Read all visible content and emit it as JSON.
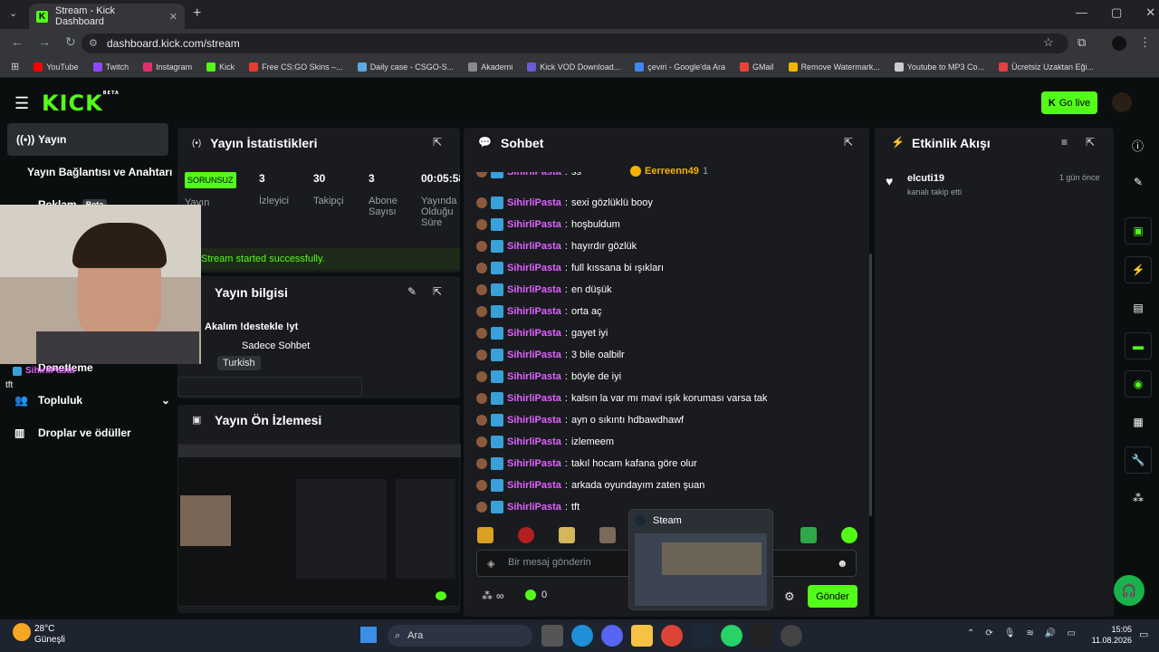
{
  "browser": {
    "tab_title": "Stream - Kick Dashboard",
    "url": "dashboard.kick.com/stream"
  },
  "bookmarks": [
    {
      "label": "YouTube",
      "color": "#ff0000"
    },
    {
      "label": "Twitch",
      "color": "#9146ff"
    },
    {
      "label": "Instagram",
      "color": "#e1306c"
    },
    {
      "label": "Kick",
      "color": "#53fc18"
    },
    {
      "label": "Free CS:GO Skins –...",
      "color": "#e63b2e"
    },
    {
      "label": "Daily case - CSGO-S...",
      "color": "#5aa9e6"
    },
    {
      "label": "Akademi",
      "color": "#8a8a8a"
    },
    {
      "label": "Kick VOD Download...",
      "color": "#6b5bd6"
    },
    {
      "label": "çeviri - Google'da Ara",
      "color": "#4285f4"
    },
    {
      "label": "GMail",
      "color": "#ea4335"
    },
    {
      "label": "Remove Watermark...",
      "color": "#f5b400"
    },
    {
      "label": "Youtube to MP3 Co...",
      "color": "#cccccc"
    },
    {
      "label": "Ücretsiz Uzaktan Eği...",
      "color": "#e04040"
    }
  ],
  "header": {
    "logo": "KICK",
    "logo_sup": "BETA",
    "go_live": "Go live"
  },
  "sidebar": {
    "items": [
      "Yayın",
      "Yayın Bağlantısı ve Anahtarı",
      "Reklam",
      "Beta",
      "Denetleme",
      "Topluluk",
      "Droplar ve ödüller"
    ]
  },
  "overlay": {
    "chat_name": "SihirliPasta",
    "chat_msg": "tft"
  },
  "stats": {
    "title": "Yayın İstatistikleri",
    "status": "SORUNSUZ",
    "status_label": "Yayın",
    "viewers": "3",
    "viewers_label": "İzleyici",
    "followers": "30",
    "followers_label": "Takipçi",
    "subs": "3",
    "subs_label": "Abone Sayısı",
    "time": "00:05:58",
    "time_label": "Yayında Olduğu Süre",
    "success": "Stream started successfully."
  },
  "info": {
    "title": "Yayın bilgisi",
    "stream_title": "Akalım !destekle !yt",
    "category": "Sadece Sohbet",
    "tag": "Turkish"
  },
  "preview": {
    "title": "Yayın Ön İzlemesi"
  },
  "chat": {
    "title": "Sohbet",
    "top_user": "Eerreenn49",
    "top_count": "1",
    "partial_msg": "ss",
    "messages": [
      "sexi gözlüklü booy",
      "hoşbuldum",
      "hayırdır gözlük",
      "full kıssana bi ışıkları",
      "en düşük",
      "orta aç",
      "gayet iyi",
      "3 bile oalbilr",
      "böyle de iyi",
      "kalsın la var mı mavi ışık koruması varsa tak",
      "ayn o sıkıntı hdbawdhawf",
      "izlemeem",
      "takıl hocam kafana göre olur",
      "arkada oyundayım zaten şuan",
      "tft"
    ],
    "username": "SihirliPasta",
    "placeholder": "Bir mesaj gönderin",
    "send": "Gönder",
    "points": "0"
  },
  "steam_popup": {
    "title": "Steam"
  },
  "activity": {
    "title": "Etkinlik Akışı",
    "user": "elcuti19",
    "action": "kanalı takip etti",
    "time": "1 gün önce"
  },
  "taskbar": {
    "temp": "28°C",
    "weather": "Güneşli",
    "search": "Ara",
    "time": "15:05",
    "date": "11.08.2026"
  }
}
